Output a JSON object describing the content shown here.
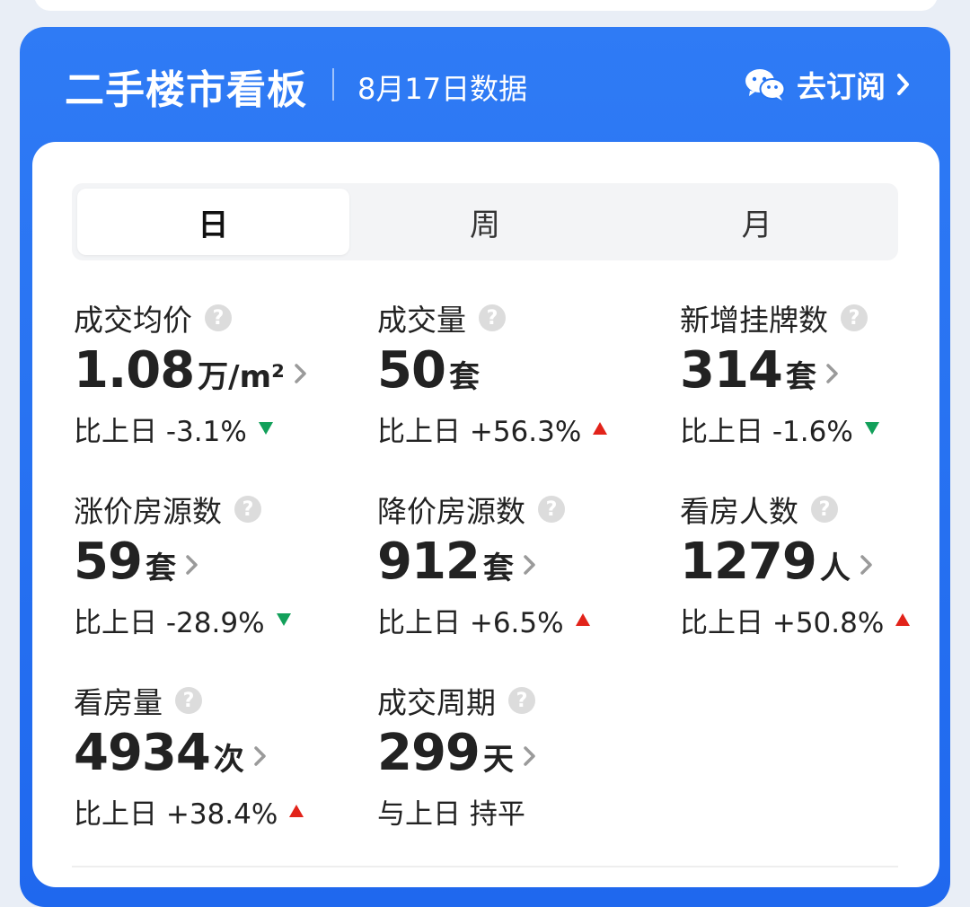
{
  "header": {
    "title": "二手楼市看板",
    "date": "8月17日数据",
    "subscribe_label": "去订阅"
  },
  "tabs": [
    {
      "label": "日",
      "active": true
    },
    {
      "label": "周",
      "active": false
    },
    {
      "label": "月",
      "active": false
    }
  ],
  "colors": {
    "brand_blue": "#2474f3",
    "up_red": "#e2231a",
    "down_green": "#12a05a"
  },
  "metrics": [
    {
      "label": "成交均价",
      "value": "1.08",
      "unit": "万/m²",
      "compare": "比上日 -3.1%",
      "trend": "down"
    },
    {
      "label": "成交量",
      "value": "50",
      "unit": "套",
      "compare": "比上日 +56.3%",
      "trend": "up"
    },
    {
      "label": "新增挂牌数",
      "value": "314",
      "unit": "套",
      "compare": "比上日 -1.6%",
      "trend": "down"
    },
    {
      "label": "涨价房源数",
      "value": "59",
      "unit": "套",
      "compare": "比上日 -28.9%",
      "trend": "down"
    },
    {
      "label": "降价房源数",
      "value": "912",
      "unit": "套",
      "compare": "比上日 +6.5%",
      "trend": "up"
    },
    {
      "label": "看房人数",
      "value": "1279",
      "unit": "人",
      "compare": "比上日 +50.8%",
      "trend": "up"
    },
    {
      "label": "看房量",
      "value": "4934",
      "unit": "次",
      "compare": "比上日 +38.4%",
      "trend": "up"
    },
    {
      "label": "成交周期",
      "value": "299",
      "unit": "天",
      "compare": "与上日 持平",
      "trend": "flat"
    }
  ]
}
